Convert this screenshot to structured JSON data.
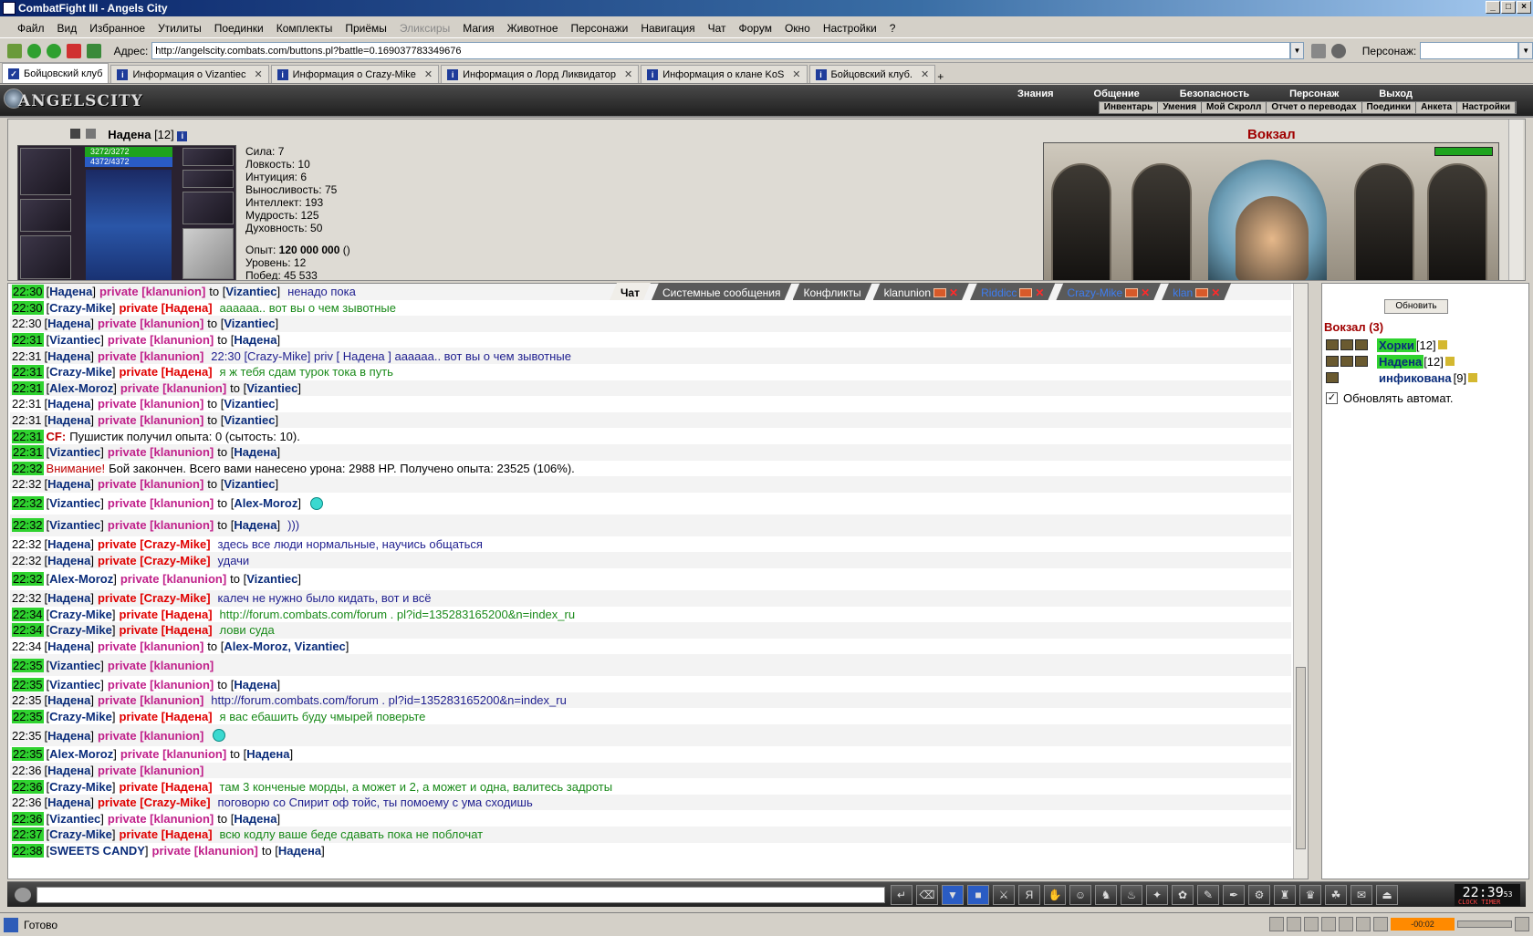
{
  "window": {
    "title": "CombatFight III - Angels City"
  },
  "menu": [
    "Файл",
    "Вид",
    "Избранное",
    "Утилиты",
    "Поединки",
    "Комплекты",
    "Приёмы",
    "Эликсиры",
    "Магия",
    "Животное",
    "Персонажи",
    "Навигация",
    "Чат",
    "Форум",
    "Окно",
    "Настройки",
    "?"
  ],
  "address": {
    "label": "Адрес:",
    "url": "http://angelscity.combats.com/buttons.pl?battle=0.169037783349676",
    "pers_label": "Персонаж:"
  },
  "tabs": [
    {
      "label": "Бойцовский клуб"
    },
    {
      "label": "Информация о Vizantiec"
    },
    {
      "label": "Информация о Crazy-Mike"
    },
    {
      "label": "Информация о Лорд Ликвидатор"
    },
    {
      "label": "Информация о клане KoS"
    },
    {
      "label": "Бойцовский клуб."
    }
  ],
  "game": {
    "logo": "ANGELSCITY",
    "nav_top": [
      "Знания",
      "Общение",
      "Безопасность",
      "Персонаж",
      "Выход"
    ],
    "nav_sub": [
      "Инвентарь",
      "Умения",
      "Мой Скролл",
      "Отчет о переводах",
      "Поединки",
      "Анкета",
      "Настройки"
    ]
  },
  "character": {
    "name": "Надена",
    "level": "[12]",
    "hp": "3272/3272",
    "mp": "4372/4372",
    "stats": [
      "Сила: 7",
      "Ловкость: 10",
      "Интуиция: 6",
      "Выносливость: 75",
      "Интеллект: 193",
      "Мудрость: 125",
      "Духовность: 50"
    ],
    "exp_label": "Опыт:",
    "exp_value": "120 000 000",
    "exp_suffix": "()",
    "level_line": "Уровень: 12",
    "wins_line": "Побед: 45 533"
  },
  "location": {
    "title": "Вокзал"
  },
  "chat_tabs": [
    {
      "label": "Чат",
      "active": true
    },
    {
      "label": "Системные сообщения"
    },
    {
      "label": "Конфликты"
    },
    {
      "label": "klanunion",
      "closable": true
    },
    {
      "label": "Riddicc",
      "closable": true,
      "blue": true
    },
    {
      "label": "Crazy-Mike",
      "closable": true,
      "blue": true
    },
    {
      "label": "klan",
      "closable": true,
      "blue": true
    }
  ],
  "chat": [
    {
      "time": "22:30",
      "hl": true,
      "from": "Надена",
      "priv": "klanunion",
      "to": "Vizantiec",
      "msg": "ненадо пока"
    },
    {
      "time": "22:30",
      "hl": true,
      "from": "Crazy-Mike",
      "priv": "Надена",
      "red": true,
      "msg": "аааааа.. вот вы о чем зывотные",
      "green": true
    },
    {
      "time": "22:30",
      "from": "Надена",
      "priv": "klanunion",
      "to": "Vizantiec",
      "msg": ""
    },
    {
      "time": "22:31",
      "hl": true,
      "from": "Vizantiec",
      "priv": "klanunion",
      "to": "Надена",
      "msg": ""
    },
    {
      "time": "22:31",
      "from": "Надена",
      "priv": "klanunion",
      "msg": "22:30 [Crazy-Mike] priv [ Надена ] аааааа.. вот вы о чем зывотные"
    },
    {
      "time": "22:31",
      "hl": true,
      "from": "Crazy-Mike",
      "priv": "Надена",
      "red": true,
      "msg": "я ж тебя сдам турок тока в путь",
      "green": true
    },
    {
      "time": "22:31",
      "hl": true,
      "from": "Alex-Moroz",
      "priv": "klanunion",
      "to": "Vizantiec",
      "msg": ""
    },
    {
      "time": "22:31",
      "from": "Надена",
      "priv": "klanunion",
      "to": "Vizantiec",
      "msg": ""
    },
    {
      "time": "22:31",
      "from": "Надена",
      "priv": "klanunion",
      "to": "Vizantiec",
      "msg": ""
    },
    {
      "time": "22:31",
      "hl": true,
      "sys": "CF:",
      "sysmsg": "Пушистик получил опыта: 0 (сытость: 10)."
    },
    {
      "time": "22:31",
      "hl": true,
      "from": "Vizantiec",
      "priv": "klanunion",
      "to": "Надена",
      "msg": ""
    },
    {
      "time": "22:32",
      "hl": true,
      "sys": "Внимание!",
      "sysmsg": "Бой закончен. Всего вами нанесено урона: 2988 HP. Получено опыта: 23525 (106%)."
    },
    {
      "time": "22:32",
      "from": "Надена",
      "priv": "klanunion",
      "to": "Vizantiec",
      "msg": ""
    },
    {
      "time": "22:32",
      "hl": true,
      "from": "Vizantiec",
      "priv": "klanunion",
      "to": "Alex-Moroz",
      "msg": "",
      "smiley": true
    },
    {
      "time": "22:32",
      "hl": true,
      "from": "Vizantiec",
      "priv": "klanunion",
      "to": "Надена",
      "msg": ")))"
    },
    {
      "time": "22:32",
      "from": "Надена",
      "priv": "Crazy-Mike",
      "red": true,
      "msg": "здесь все люди нормальные, научись общаться"
    },
    {
      "time": "22:32",
      "from": "Надена",
      "priv": "Crazy-Mike",
      "red": true,
      "msg": "удачи"
    },
    {
      "time": "22:32",
      "hl": true,
      "from": "Alex-Moroz",
      "priv": "klanunion",
      "to": "Vizantiec",
      "msg": ""
    },
    {
      "time": "22:32",
      "from": "Надена",
      "priv": "Crazy-Mike",
      "red": true,
      "msg": "калеч не нужно было кидать, вот и всё"
    },
    {
      "time": "22:34",
      "hl": true,
      "from": "Crazy-Mike",
      "priv": "Надена",
      "red": true,
      "msg": "http://forum.combats.com/forum . pl?id=135283165200&n=index_ru",
      "green": true
    },
    {
      "time": "22:34",
      "hl": true,
      "from": "Crazy-Mike",
      "priv": "Надена",
      "red": true,
      "msg": "лови суда",
      "green": true
    },
    {
      "time": "22:34",
      "from": "Надена",
      "priv": "klanunion",
      "to": "Alex-Moroz, Vizantiec",
      "msg": ""
    },
    {
      "time": "22:35",
      "hl": true,
      "from": "Vizantiec",
      "priv": "klanunion",
      "msg": ""
    },
    {
      "time": "22:35",
      "hl": true,
      "from": "Vizantiec",
      "priv": "klanunion",
      "to": "Надена",
      "msg": ""
    },
    {
      "time": "22:35",
      "from": "Надена",
      "priv": "klanunion",
      "msg": "http://forum.combats.com/forum . pl?id=135283165200&n=index_ru"
    },
    {
      "time": "22:35",
      "hl": true,
      "from": "Crazy-Mike",
      "priv": "Надена",
      "red": true,
      "msg": "я вас ебашить буду чмырей поверьте",
      "green": true
    },
    {
      "time": "22:35",
      "from": "Надена",
      "priv": "klanunion",
      "msg": "",
      "smiley": true
    },
    {
      "time": "22:35",
      "hl": true,
      "from": "Alex-Moroz",
      "priv": "klanunion",
      "to": "Надена",
      "msg": ""
    },
    {
      "time": "22:36",
      "from": "Надена",
      "priv": "klanunion",
      "msg": ""
    },
    {
      "time": "22:36",
      "hl": true,
      "from": "Crazy-Mike",
      "priv": "Надена",
      "red": true,
      "msg": "там 3 конченые морды, а может и 2, а может и одна, валитесь задроты",
      "green": true
    },
    {
      "time": "22:36",
      "from": "Надена",
      "priv": "Crazy-Mike",
      "red": true,
      "msg": "поговорю со Спирит оф тойс, ты помоему с ума сходишь"
    },
    {
      "time": "22:36",
      "hl": true,
      "from": "Vizantiec",
      "priv": "klanunion",
      "to": "Надена",
      "msg": ""
    },
    {
      "time": "22:37",
      "hl": true,
      "from": "Crazy-Mike",
      "priv": "Надена",
      "red": true,
      "msg": "всю кодлу ваше беде сдавать пока не поблочат",
      "green": true
    },
    {
      "time": "22:38",
      "hl": true,
      "from": "SWEETS CANDY",
      "priv": "klanunion",
      "to": "Надена",
      "msg": ""
    }
  ],
  "room": {
    "refresh_label": "Обновить",
    "title": "Вокзал (3)",
    "users": [
      {
        "name": "Хорки",
        "level": "[12]",
        "hl": true
      },
      {
        "name": "Надена",
        "level": "[12]",
        "hl": true
      },
      {
        "name": "инфикована",
        "level": "[9]",
        "hl": false
      }
    ],
    "auto_label": "Обновлять автомат."
  },
  "clock": {
    "time": "22:39",
    "sec": "53",
    "label": "CLOCK TIMER"
  },
  "status": {
    "text": "Готово",
    "timer": "-00:02"
  },
  "colors": {
    "accent": "#0a2c7a",
    "private": "#c0208a",
    "private_red": "#e00000",
    "timestamp_hl": "#2fd22f",
    "location": "#a00000"
  }
}
